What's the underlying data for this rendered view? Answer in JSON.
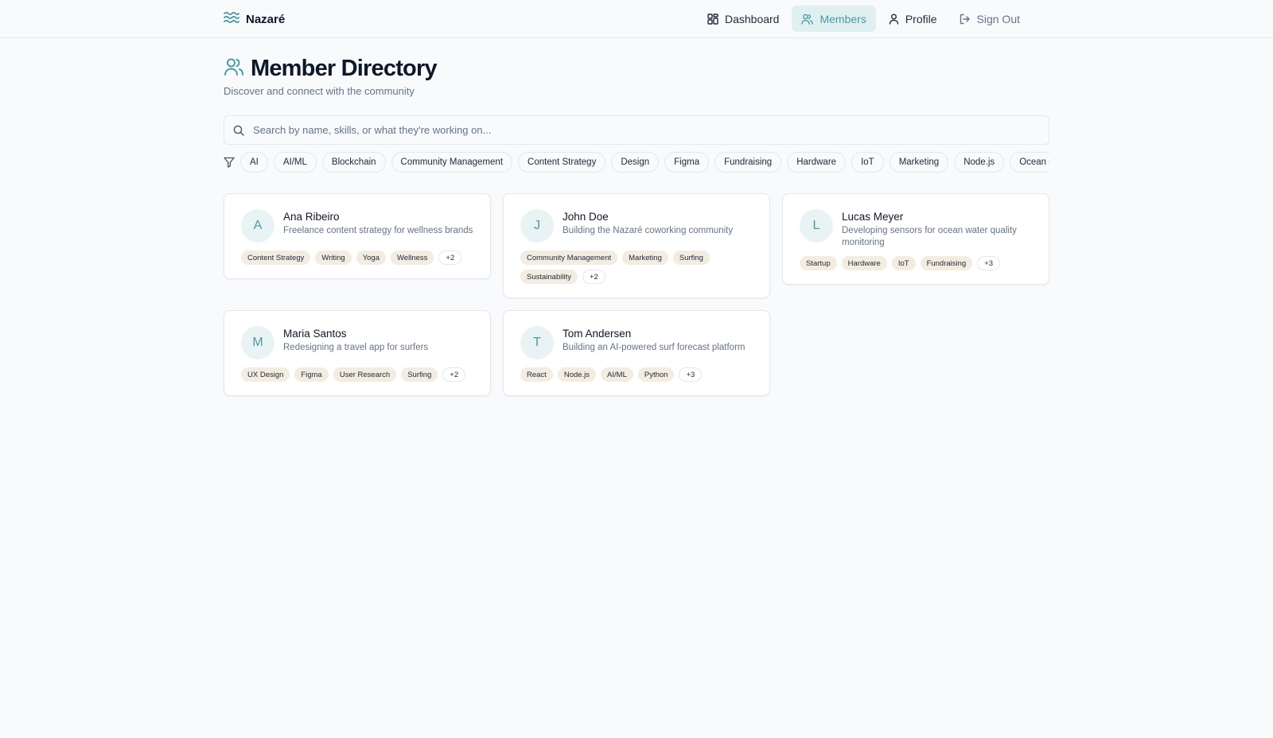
{
  "brand": {
    "name": "Nazaré",
    "icon": "waves-icon"
  },
  "nav": {
    "items": [
      {
        "label": "Dashboard",
        "icon": "dashboard-icon"
      },
      {
        "label": "Members",
        "icon": "users-icon",
        "active": true
      },
      {
        "label": "Profile",
        "icon": "user-icon"
      },
      {
        "label": "Sign Out",
        "icon": "sign-out-icon"
      }
    ]
  },
  "page": {
    "title": "Member Directory",
    "subtitle": "Discover and connect with the community",
    "icon": "users-icon"
  },
  "search": {
    "placeholder": "Search by name, skills, or what they're working on...",
    "value": ""
  },
  "filters": {
    "icon": "filter-icon",
    "tags": [
      "AI",
      "AI/ML",
      "Blockchain",
      "Community Management",
      "Content Strategy",
      "Design",
      "Figma",
      "Fundraising",
      "Hardware",
      "IoT",
      "Marketing",
      "Node.js",
      "Ocean Conservation"
    ]
  },
  "members": [
    {
      "initial": "A",
      "name": "Ana Ribeiro",
      "bio": "Freelance content strategy for wellness brands",
      "tags": [
        "Content Strategy",
        "Writing",
        "Yoga",
        "Wellness"
      ],
      "more": "+2"
    },
    {
      "initial": "J",
      "name": "John Doe",
      "bio": "Building the Nazaré coworking community",
      "tags": [
        "Community Management",
        "Marketing",
        "Surfing",
        "Sustainability"
      ],
      "more": "+2"
    },
    {
      "initial": "L",
      "name": "Lucas Meyer",
      "bio": "Developing sensors for ocean water quality monitoring",
      "tags": [
        "Startup",
        "Hardware",
        "IoT",
        "Fundraising"
      ],
      "more": "+3"
    },
    {
      "initial": "M",
      "name": "Maria Santos",
      "bio": "Redesigning a travel app for surfers",
      "tags": [
        "UX Design",
        "Figma",
        "User Research",
        "Surfing"
      ],
      "more": "+2"
    },
    {
      "initial": "T",
      "name": "Tom Andersen",
      "bio": "Building an AI-powered surf forecast platform",
      "tags": [
        "React",
        "Node.js",
        "AI/ML",
        "Python"
      ],
      "more": "+3"
    }
  ],
  "colors": {
    "accent": "#4a9aa5",
    "accent_bg": "#e0f0f1",
    "tag_bg": "#f3ece0",
    "background": "#f8fafc"
  }
}
